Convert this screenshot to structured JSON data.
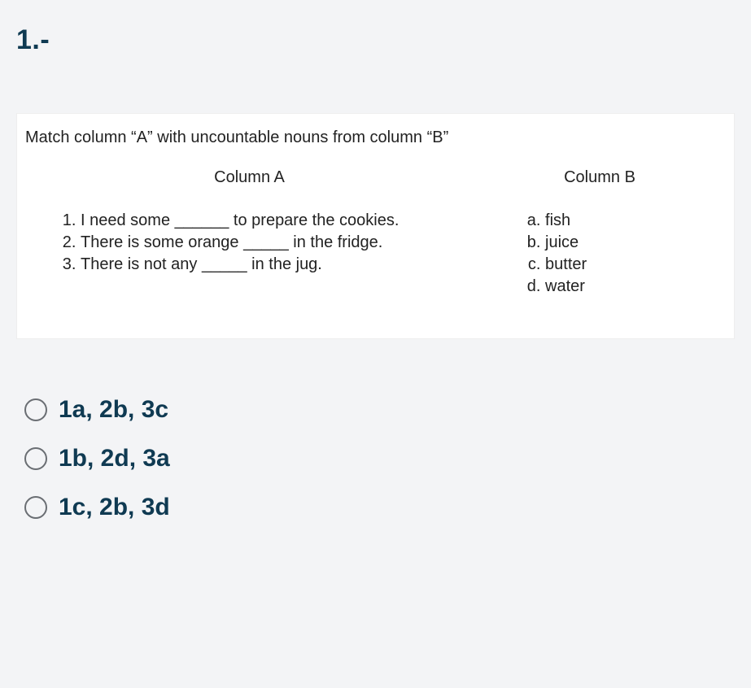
{
  "question_number": "1.-",
  "prompt": {
    "instruction": "Match column “A” with uncountable nouns from column “B”",
    "columnA": {
      "header": "Column A",
      "items": [
        "I need some ______ to prepare the cookies.",
        "There is some orange _____ in the fridge.",
        "There is not any _____ in the jug."
      ]
    },
    "columnB": {
      "header": "Column B",
      "items": [
        "fish",
        "juice",
        "butter",
        "water"
      ]
    }
  },
  "options": [
    {
      "label": "1a, 2b, 3c"
    },
    {
      "label": "1b, 2d, 3a"
    },
    {
      "label": "1c, 2b, 3d"
    }
  ]
}
